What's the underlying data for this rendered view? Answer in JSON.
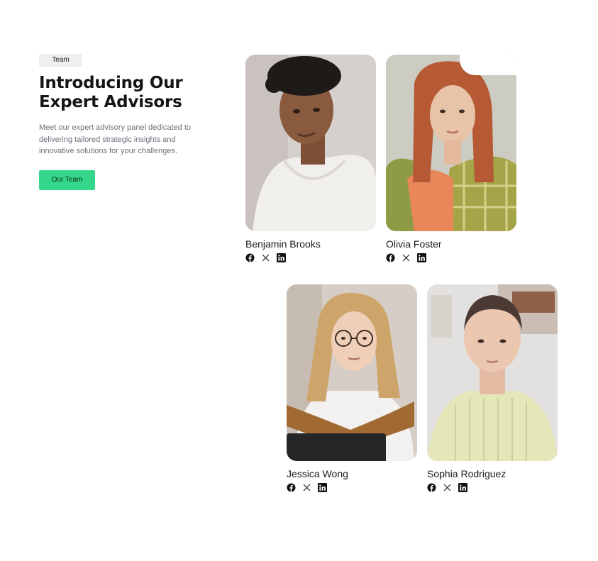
{
  "section": {
    "badge": "Team",
    "heading": "Introducing Our Expert Advisors",
    "description": "Meet our expert advisory panel dedicated to delivering tailored strategic insights and innovative solutions for your challenges.",
    "cta_label": "Our Team"
  },
  "members": [
    {
      "name": "Benjamin Brooks",
      "socials": [
        "facebook-icon",
        "x-icon",
        "linkedin-icon"
      ]
    },
    {
      "name": "Olivia Foster",
      "socials": [
        "facebook-icon",
        "x-icon",
        "linkedin-icon"
      ]
    },
    {
      "name": "Jessica Wong",
      "socials": [
        "facebook-icon",
        "x-icon",
        "linkedin-icon"
      ]
    },
    {
      "name": "Sophia Rodriguez",
      "socials": [
        "facebook-icon",
        "x-icon",
        "linkedin-icon"
      ]
    }
  ],
  "colors": {
    "accent": "#34d68a",
    "badge_bg": "#efefef",
    "heading": "#151515",
    "body_text": "#6d6f7a"
  }
}
